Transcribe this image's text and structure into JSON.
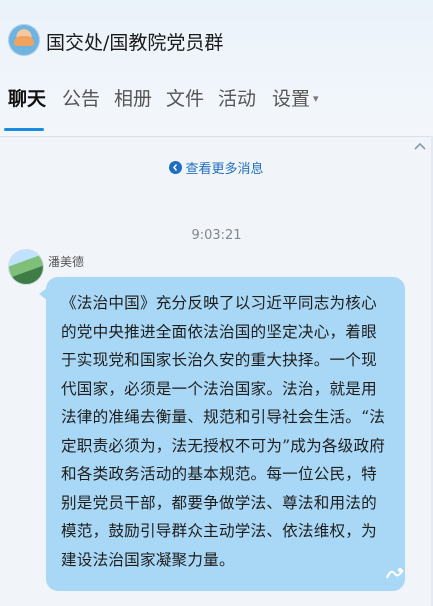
{
  "header": {
    "group_title": "国交处/国教院党员群",
    "tabs": [
      {
        "label": "聊天",
        "active": true
      },
      {
        "label": "公告",
        "active": false
      },
      {
        "label": "相册",
        "active": false
      },
      {
        "label": "文件",
        "active": false
      },
      {
        "label": "活动",
        "active": false
      },
      {
        "label": "设置",
        "active": false
      }
    ],
    "settings_caret": "▾"
  },
  "chat": {
    "more_messages": "查看更多消息",
    "timestamp": "9:03:21",
    "message": {
      "sender": "潘美德",
      "text": "《法治中国》充分反映了以习近平同志为核心的党中央推进全面依法治国的坚定决心，着眼于实现党和国家长治久安的重大抉择。一个现代国家，必须是一个法治国家。法治，就是用法律的准绳去衡量、规范和引导社会生活。“法定职责必须为，法无授权不可为”成为各级政府和各类政务活动的基本规范。每一位公民，特别是党员干部，都要争做学法、尊法和用法的模范，鼓励引导群众主动学法、依法维权，为建设法治国家凝聚力量。"
    }
  },
  "colors": {
    "accent": "#1a8be0",
    "bubble": "#a9d8f6",
    "link": "#1f6fc0"
  },
  "icons": {
    "more_messages": "clock-arrow-icon",
    "collapse": "chevron-up-icon",
    "bubble_decoration": "wave-icon"
  }
}
